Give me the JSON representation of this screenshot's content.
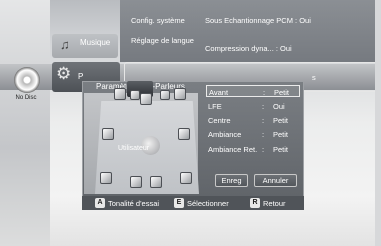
{
  "left_status": {
    "disc_text": "No Disc"
  },
  "categories": {
    "music": "Musique",
    "settings": "P"
  },
  "menu": {
    "items": [
      {
        "label": "Config. système"
      },
      {
        "label": "Réglage de langue"
      },
      {
        "label": "Sous Echantionnage PCM  :  Oui"
      },
      {
        "label": "Compression dyna...  :  Oui"
      },
      {
        "label": "s"
      }
    ]
  },
  "dialog": {
    "title": "Paramètre Haut-Parleurs",
    "listener_label": "Utilisateur",
    "settings": [
      {
        "label": "Avant",
        "sep": ":",
        "value": "Petit"
      },
      {
        "label": "LFE",
        "sep": ":",
        "value": "Oui"
      },
      {
        "label": "Centre",
        "sep": ":",
        "value": "Petit"
      },
      {
        "label": "Ambiance",
        "sep": ":",
        "value": "Petit"
      },
      {
        "label": "Ambiance Ret.",
        "sep": ":",
        "value": "Petit"
      }
    ],
    "buttons": {
      "save": "Enreg",
      "cancel": "Annuler"
    }
  },
  "footer": {
    "items": [
      {
        "key": "A",
        "label": "Tonalité d'essai"
      },
      {
        "key": "E",
        "label": "Sélectionner"
      },
      {
        "key": "R",
        "label": "Retour"
      }
    ]
  }
}
